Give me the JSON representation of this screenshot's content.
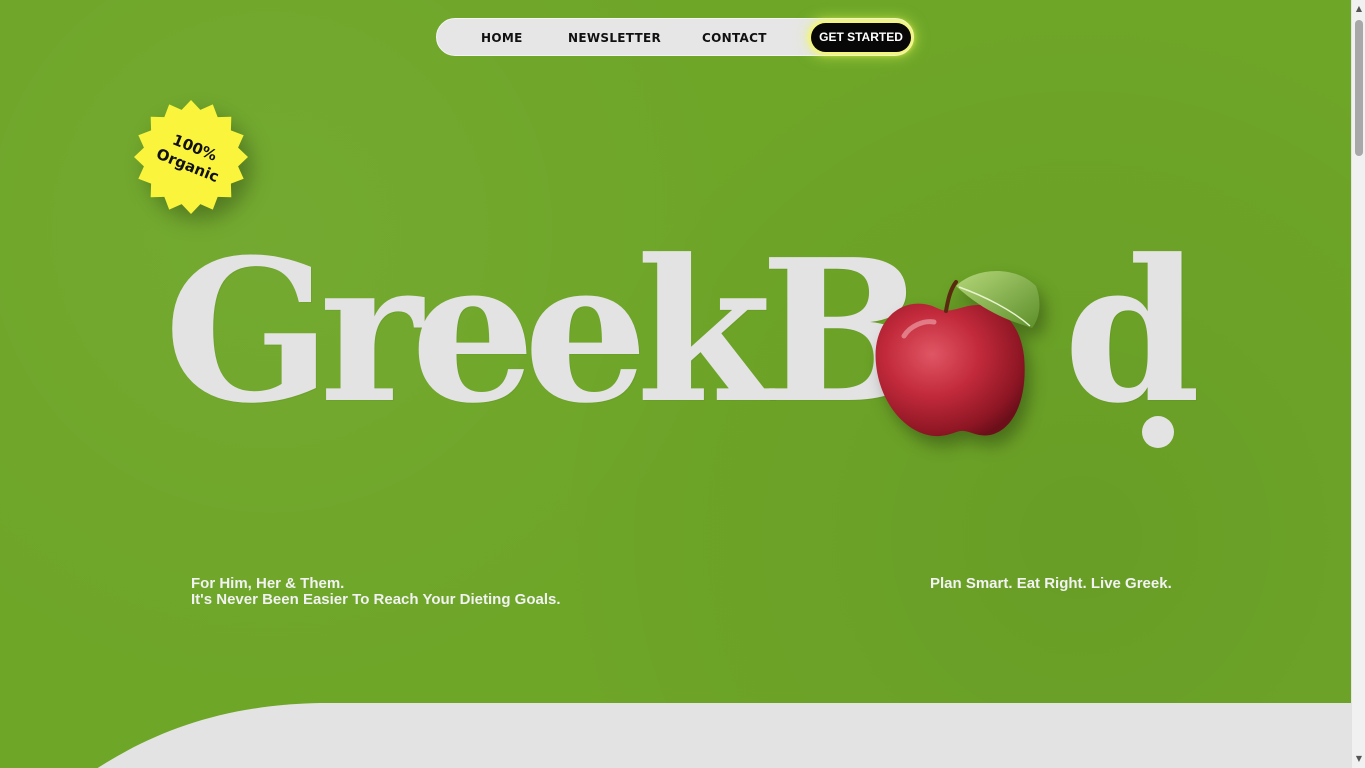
{
  "nav": {
    "home": "HOME",
    "newsletter": "NEWSLETTER",
    "contact": "CONTACT",
    "cta": "GET STARTED"
  },
  "badge": {
    "line1": "100%",
    "line2": "Organic",
    "color": "#fbf43c"
  },
  "logo": {
    "word": "GreekB",
    "tail": "d",
    "apple_icon": "apple-icon"
  },
  "taglines": {
    "left_line1": "For Him, Her & Them.",
    "left_line2": "It's Never Been Easier To Reach Your Dieting Goals.",
    "right": "Plan Smart. Eat Right. Live Greek."
  },
  "colors": {
    "background": "#6ea628",
    "logo": "#e3e3e3",
    "cta": "#070707",
    "cta_glow": "#f7ff5a"
  }
}
